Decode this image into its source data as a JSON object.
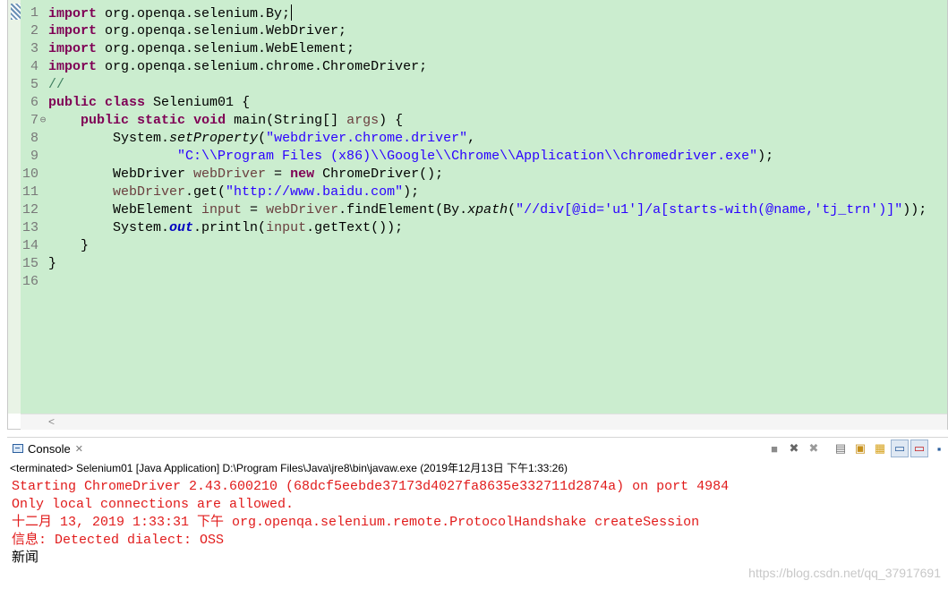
{
  "editor": {
    "lines": [
      {
        "n": "1",
        "fold": "",
        "segs": [
          {
            "t": "import",
            "c": "kw"
          },
          {
            "t": " org.openqa.selenium.By;",
            "c": ""
          }
        ],
        "caret": true
      },
      {
        "n": "2",
        "fold": "",
        "segs": [
          {
            "t": "import",
            "c": "kw"
          },
          {
            "t": " org.openqa.selenium.WebDriver;",
            "c": ""
          }
        ]
      },
      {
        "n": "3",
        "fold": "",
        "segs": [
          {
            "t": "import",
            "c": "kw"
          },
          {
            "t": " org.openqa.selenium.WebElement;",
            "c": ""
          }
        ]
      },
      {
        "n": "4",
        "fold": "",
        "segs": [
          {
            "t": "import",
            "c": "kw"
          },
          {
            "t": " org.openqa.selenium.chrome.ChromeDriver;",
            "c": ""
          }
        ]
      },
      {
        "n": "5",
        "fold": "",
        "segs": [
          {
            "t": "//",
            "c": "cm"
          }
        ]
      },
      {
        "n": "6",
        "fold": "",
        "segs": [
          {
            "t": "public",
            "c": "kw"
          },
          {
            "t": " ",
            "c": ""
          },
          {
            "t": "class",
            "c": "kw"
          },
          {
            "t": " Selenium01 {",
            "c": ""
          }
        ]
      },
      {
        "n": "7",
        "fold": "⊖",
        "segs": [
          {
            "t": "    ",
            "c": ""
          },
          {
            "t": "public",
            "c": "kw"
          },
          {
            "t": " ",
            "c": ""
          },
          {
            "t": "static",
            "c": "kw"
          },
          {
            "t": " ",
            "c": ""
          },
          {
            "t": "void",
            "c": "kw"
          },
          {
            "t": " main(String[] ",
            "c": ""
          },
          {
            "t": "args",
            "c": "var"
          },
          {
            "t": ") {",
            "c": ""
          }
        ]
      },
      {
        "n": "8",
        "fold": "",
        "segs": [
          {
            "t": "        System.",
            "c": ""
          },
          {
            "t": "setProperty",
            "c": "ital"
          },
          {
            "t": "(",
            "c": ""
          },
          {
            "t": "\"webdriver.chrome.driver\"",
            "c": "str"
          },
          {
            "t": ",",
            "c": ""
          }
        ]
      },
      {
        "n": "9",
        "fold": "",
        "segs": [
          {
            "t": "                ",
            "c": ""
          },
          {
            "t": "\"C:\\\\Program Files (x86)\\\\Google\\\\Chrome\\\\Application\\\\chromedriver.exe\"",
            "c": "str"
          },
          {
            "t": ");",
            "c": ""
          }
        ]
      },
      {
        "n": "10",
        "fold": "",
        "segs": [
          {
            "t": "        WebDriver ",
            "c": ""
          },
          {
            "t": "webDriver",
            "c": "var"
          },
          {
            "t": " = ",
            "c": ""
          },
          {
            "t": "new",
            "c": "kw"
          },
          {
            "t": " ChromeDriver();",
            "c": ""
          }
        ]
      },
      {
        "n": "11",
        "fold": "",
        "segs": [
          {
            "t": "        ",
            "c": ""
          },
          {
            "t": "webDriver",
            "c": "var"
          },
          {
            "t": ".get(",
            "c": ""
          },
          {
            "t": "\"http://www.baidu.com\"",
            "c": "str"
          },
          {
            "t": ");",
            "c": ""
          }
        ]
      },
      {
        "n": "12",
        "fold": "",
        "segs": [
          {
            "t": "        WebElement ",
            "c": ""
          },
          {
            "t": "input",
            "c": "var"
          },
          {
            "t": " = ",
            "c": ""
          },
          {
            "t": "webDriver",
            "c": "var"
          },
          {
            "t": ".findElement(By.",
            "c": ""
          },
          {
            "t": "xpath",
            "c": "ital"
          },
          {
            "t": "(",
            "c": ""
          },
          {
            "t": "\"//div[@id='u1']/a[starts-with(@name,'tj_trn')]\"",
            "c": "str"
          },
          {
            "t": "));",
            "c": ""
          }
        ]
      },
      {
        "n": "13",
        "fold": "",
        "segs": [
          {
            "t": "        System.",
            "c": ""
          },
          {
            "t": "out",
            "c": "fld"
          },
          {
            "t": ".println(",
            "c": ""
          },
          {
            "t": "input",
            "c": "var"
          },
          {
            "t": ".getText());",
            "c": ""
          }
        ]
      },
      {
        "n": "14",
        "fold": "",
        "segs": [
          {
            "t": "    }",
            "c": ""
          }
        ]
      },
      {
        "n": "15",
        "fold": "",
        "segs": [
          {
            "t": "}",
            "c": ""
          }
        ]
      },
      {
        "n": "16",
        "fold": "",
        "segs": []
      }
    ],
    "hscroll_arrow": "<"
  },
  "console": {
    "tab_label": "Console",
    "tab_close": "✕",
    "header": "<terminated> Selenium01 [Java Application] D:\\Program Files\\Java\\jre8\\bin\\javaw.exe (2019年12月13日 下午1:33:26)",
    "lines": [
      {
        "text": "Starting ChromeDriver 2.43.600210 (68dcf5eebde37173d4027fa8635e332711d2874a) on port 4984",
        "type": "err"
      },
      {
        "text": "Only local connections are allowed.",
        "type": "err"
      },
      {
        "text": "十二月 13, 2019 1:33:31 下午 org.openqa.selenium.remote.ProtocolHandshake createSession",
        "type": "err"
      },
      {
        "text": "信息: Detected dialect: OSS",
        "type": "err"
      },
      {
        "text": "新闻",
        "type": "out"
      }
    ],
    "toolbar": [
      {
        "name": "terminate-icon",
        "glyph": "■",
        "color": "#8c8c8c"
      },
      {
        "name": "remove-launch-icon",
        "glyph": "✖",
        "color": "#666666"
      },
      {
        "name": "remove-all-terminated-icon",
        "glyph": "✖",
        "color": "#9a9a9a"
      },
      {
        "name": "sep"
      },
      {
        "name": "clear-console-icon",
        "glyph": "▤",
        "color": "#6f6f6f"
      },
      {
        "name": "scroll-lock-icon",
        "glyph": "▣",
        "color": "#c7901a"
      },
      {
        "name": "word-wrap-icon",
        "glyph": "▦",
        "color": "#d6a21c"
      },
      {
        "name": "show-stdout-icon",
        "glyph": "▭",
        "color": "#2b5f9e",
        "pressed": true
      },
      {
        "name": "show-stderr-icon",
        "glyph": "▭",
        "color": "#c62020",
        "pressed": true
      },
      {
        "name": "pin-console-icon",
        "glyph": "▪",
        "color": "#2b5f9e"
      }
    ]
  },
  "watermark": "https://blog.csdn.net/qq_37917691"
}
